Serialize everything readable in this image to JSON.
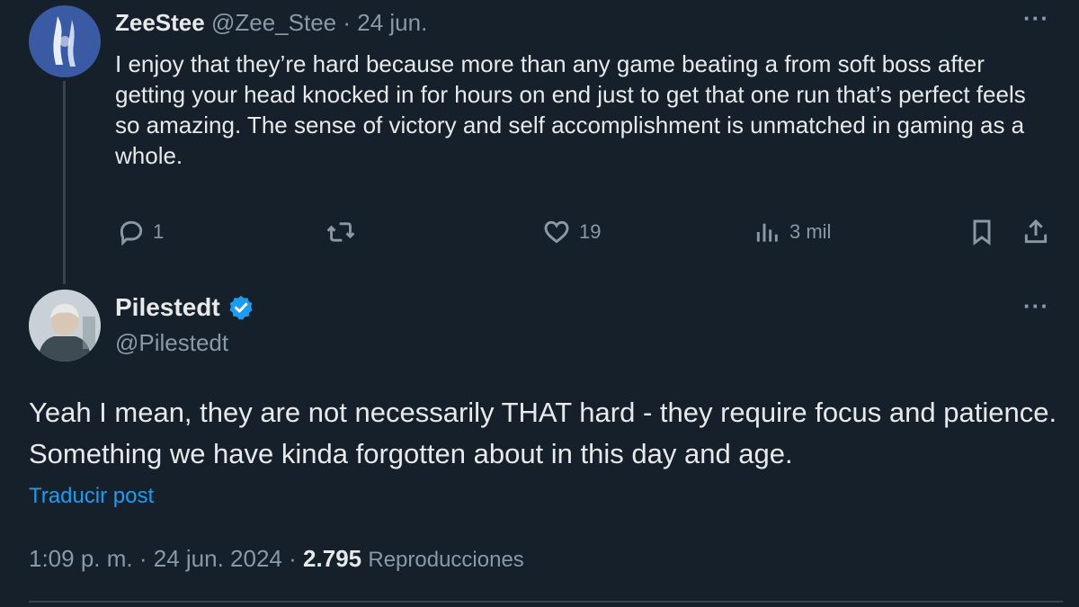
{
  "reply_to": {
    "display_name": "ZeeStee",
    "handle": "@Zee_Stee",
    "date": "24 jun.",
    "text": "I enjoy that they’re hard because more than any game beating a from soft boss after getting your head knocked in for hours on end just to get that one run that’s perfect feels so amazing. The sense of victory and self accomplishment is unmatched in gaming as a whole.",
    "actions": {
      "replies": "1",
      "reposts": "",
      "likes": "19",
      "views": "3 mil"
    }
  },
  "main_tweet": {
    "display_name": "Pilestedt",
    "handle": "@Pilestedt",
    "verified": true,
    "text": "Yeah I mean, they are not necessarily THAT hard - they require focus and patience. Something we have kinda forgotten about in this day and age.",
    "translate_label": "Traducir post",
    "time": "1:09 p. m.",
    "date": "24 jun. 2024",
    "views_count": "2.795",
    "views_label": "Reproducciones"
  },
  "ui": {
    "more_glyph": "···",
    "separator": "·"
  },
  "colors": {
    "background": "#15202b",
    "text": "#e7e9ea",
    "muted": "#8b98a5",
    "accent": "#1d9bf0",
    "thread_line": "#38444d"
  },
  "icons": [
    "reply-icon",
    "repost-icon",
    "like-icon",
    "views-icon",
    "bookmark-icon",
    "share-icon",
    "verified-badge-icon",
    "more-icon"
  ]
}
